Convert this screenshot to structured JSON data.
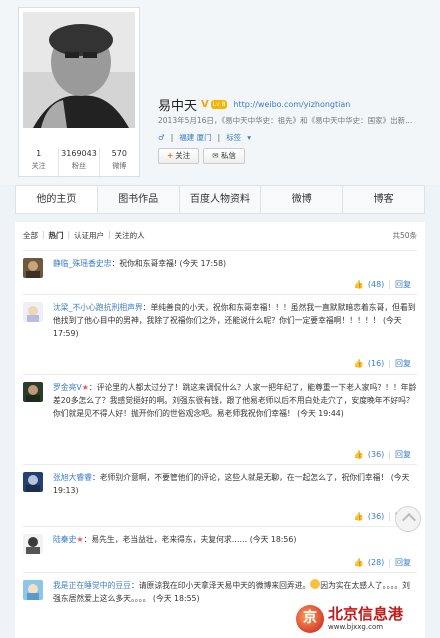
{
  "profile": {
    "name": "易中天",
    "level": "Lv 8",
    "url": "http://weibo.com/yizhongtian",
    "date": "2013年5月16日，",
    "meta_rest": "《易中天中华史：祖先》和《易中天中华史：国家》出新...",
    "location": "福建 厦门",
    "tags": "标签",
    "follow_label": "关注",
    "message_label": "私信"
  },
  "stats": [
    {
      "num": "1",
      "label": "关注"
    },
    {
      "num": "3169043",
      "label": "粉丝"
    },
    {
      "num": "570",
      "label": "微博"
    }
  ],
  "tabs": [
    "他的主页",
    "图书作品",
    "百度人物资料",
    "微博",
    "博客"
  ],
  "filter": {
    "all": "全部",
    "hot": "热门",
    "verified": "认证用户",
    "followed": "关注的人",
    "total": "共50条"
  },
  "comments": [
    {
      "user": "静临_殊瑶香史忠",
      "text": "：祝你和东哥幸福! (今天 17:58)",
      "likes": "(48)",
      "reply": "回复"
    },
    {
      "user": "沈梁_不小心跑抗刑相声界",
      "text": "：单纯善良的小天，祝你和东哥幸福！！！虽然我一直默默暗恋着东哥，但看到他找到了他心目中的男神，我除了祝福你们之外，还能说什么呢？你们一定要幸福啊！！！！！ (今天 17:59)",
      "likes": "(16)",
      "reply": "回复"
    },
    {
      "user": "罗金亮V",
      "text": "：评论里的人都太过分了！跳这来调侃什么？人家一把年纪了，能尊重一下老人家吗？！！年龄差20多怎么了？我感觉挺好的啊。刘强东很有钱，跟了他易老师以后不用白处走穴了，安度晚年不好吗？你们就是见不得人好！抛开你们的世俗观念吧。易老师我祝你们幸福！ (今天 19:44)",
      "likes": "(36)",
      "reply": "回复"
    },
    {
      "user": "张旭大睿睿",
      "text": "：老师别介意啊，不要管他们的评论，这些人就是无聊，在一起怎么了，祝你们幸福！ (今天 19:13)",
      "likes": "(36)",
      "reply": "回复"
    },
    {
      "user": "陆秦史",
      "text": "：易先生，老当益壮，老来得东，夫复何求…… (今天 18:56)",
      "likes": "(28)",
      "reply": "回复"
    },
    {
      "user": "我是正在睡觉中的豆豆",
      "text": "：请原谅我在印小天拿泽天易中天的微博来回弄进。",
      "text2": "因为实在太感人了。。。。刘强东居然爱上这么多天。。。。 (今天 18:55)",
      "likes": "",
      "reply": ""
    }
  ],
  "watermark": {
    "logo": "京",
    "title": "北京信息港",
    "sub": "www.bjxxg.com"
  },
  "colors": {
    "link": "#3a7bc7",
    "accent": "#e96c00",
    "watermark": "#c11a1a"
  }
}
